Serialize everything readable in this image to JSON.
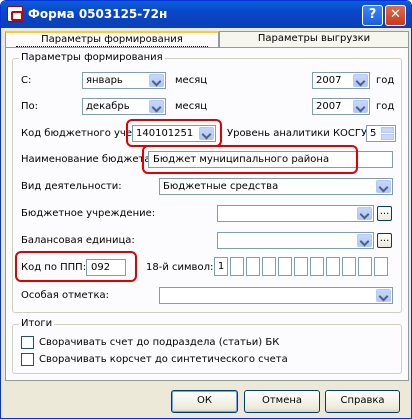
{
  "window": {
    "title": "Форма 0503125-72н",
    "help_label": "?",
    "close_label": "✕"
  },
  "tabs": [
    {
      "label": "Параметры формирования",
      "active": true
    },
    {
      "label": "Параметры выгрузки",
      "active": false
    }
  ],
  "params": {
    "group_title": "Параметры формирования",
    "from": {
      "label": "С:",
      "month_value": "январь",
      "month_label": "месяц",
      "year_value": "2007",
      "year_label": "год"
    },
    "to": {
      "label": "По:",
      "month_value": "декабрь",
      "month_label": "месяц",
      "year_value": "2007",
      "year_label": "год"
    },
    "budget_code": {
      "label": "Код бюджетного учета:",
      "value": "140101251"
    },
    "kosgu_level": {
      "label": "Уровень аналитики КОСГУ:",
      "value": "5"
    },
    "budget_name": {
      "label": "Наименование бюджета:",
      "value": "Бюджет муниципального района"
    },
    "activity": {
      "label": "Вид деятельности:",
      "value": "Бюджетные средства"
    },
    "institution": {
      "label": "Бюджетное учреждение:",
      "value": ""
    },
    "balance_unit": {
      "label": "Балансовая единица:",
      "value": ""
    },
    "ppp_code": {
      "label": "Код по ППП:",
      "value": "092"
    },
    "char18": {
      "label": "18-й символ:",
      "cells": [
        "1",
        "",
        "",
        "",
        "",
        "",
        "",
        "",
        "",
        "",
        ""
      ]
    },
    "special_mark": {
      "label": "Особая отметка:",
      "value": ""
    },
    "ellipsis": "..."
  },
  "totals": {
    "group_title": "Итоги",
    "collapse_by_section": {
      "label": "Сворачивать счет до подраздела (статьи) БК",
      "checked": false
    },
    "collapse_to_synthetic": {
      "label": "Сворачивать корсчет до синтетического счета",
      "checked": false
    }
  },
  "buttons": {
    "ok": "ОК",
    "cancel": "Отмена",
    "help": "Справка"
  },
  "colors": {
    "title_bar": "#0a50d0",
    "highlight": "#e00000",
    "active_tab_accent": "#ffc83c"
  }
}
